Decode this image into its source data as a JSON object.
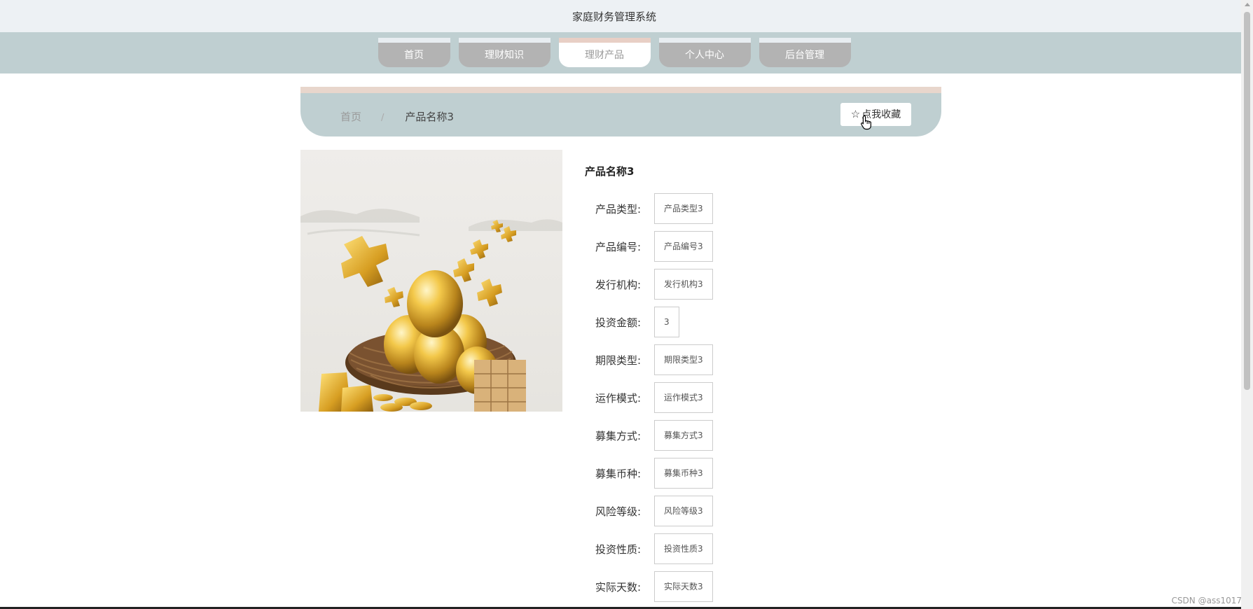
{
  "header": {
    "site_title": "家庭财务管理系统"
  },
  "nav": {
    "tabs": [
      {
        "label": "首页"
      },
      {
        "label": "理财知识"
      },
      {
        "label": "理财产品",
        "active": true
      },
      {
        "label": "个人中心"
      },
      {
        "label": "后台管理"
      }
    ]
  },
  "breadcrumb": {
    "home": "首页",
    "separator": "/",
    "current": "产品名称3"
  },
  "favorite_button": {
    "label": "点我收藏",
    "icon": "star-outline-icon"
  },
  "product": {
    "title": "产品名称3",
    "fields": [
      {
        "label": "产品类型:",
        "value": "产品类型3"
      },
      {
        "label": "产品编号:",
        "value": "产品编号3"
      },
      {
        "label": "发行机构:",
        "value": "发行机构3"
      },
      {
        "label": "投资金额:",
        "value": "3"
      },
      {
        "label": "期限类型:",
        "value": "期限类型3"
      },
      {
        "label": "运作模式:",
        "value": "运作模式3"
      },
      {
        "label": "募集方式:",
        "value": "募集方式3"
      },
      {
        "label": "募集币种:",
        "value": "募集币种3"
      },
      {
        "label": "风险等级:",
        "value": "风险等级3"
      },
      {
        "label": "投资性质:",
        "value": "投资性质3"
      },
      {
        "label": "实际天数:",
        "value": "实际天数3"
      }
    ]
  },
  "watermark": "CSDN @ass1017",
  "colors": {
    "nav_bg": "#bfcfd1",
    "tab_bg": "#b3b3b3",
    "active_accent": "#e8cfc5"
  }
}
